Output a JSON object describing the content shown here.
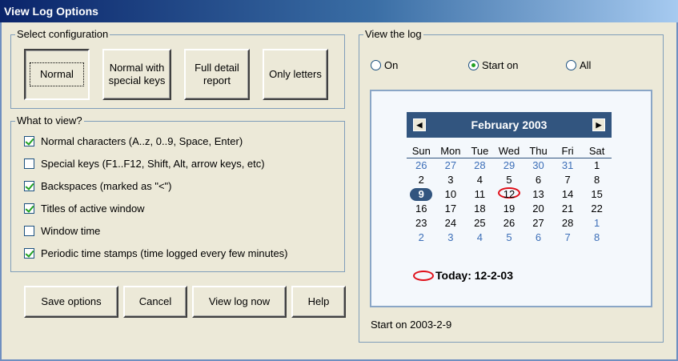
{
  "window": {
    "title": "View Log Options"
  },
  "config": {
    "legend": "Select configuration",
    "buttons": [
      {
        "id": "normal",
        "label": "Normal",
        "pressed": true
      },
      {
        "id": "normal-special",
        "label": "Normal with special keys",
        "pressed": false
      },
      {
        "id": "full-detail",
        "label": "Full detail report",
        "pressed": false
      },
      {
        "id": "only-letters",
        "label": "Only letters",
        "pressed": false
      }
    ]
  },
  "what_to_view": {
    "legend": "What to view?",
    "items": [
      {
        "label": "Normal characters (A..z, 0..9, Space, Enter)",
        "checked": true
      },
      {
        "label": "Special keys (F1..F12, Shift, Alt, arrow keys, etc)",
        "checked": false
      },
      {
        "label": "Backspaces (marked as \"<\")",
        "checked": true
      },
      {
        "label": "Titles of active window",
        "checked": true
      },
      {
        "label": "Window time",
        "checked": false
      },
      {
        "label": "Periodic time stamps (time logged every few minutes)",
        "checked": true
      }
    ]
  },
  "actions": {
    "save": "Save options",
    "cancel": "Cancel",
    "view_now": "View log now",
    "help": "Help"
  },
  "view_log": {
    "legend": "View the log",
    "radios": [
      {
        "label": "On",
        "selected": false
      },
      {
        "label": "Start on",
        "selected": true
      },
      {
        "label": "All",
        "selected": false
      }
    ],
    "status": "Start on 2003-2-9"
  },
  "calendar": {
    "month_label": "February 2003",
    "weekdays": [
      "Sun",
      "Mon",
      "Tue",
      "Wed",
      "Thu",
      "Fri",
      "Sat"
    ],
    "weeks": [
      [
        "26",
        "27",
        "28",
        "29",
        "30",
        "31",
        "1"
      ],
      [
        "2",
        "3",
        "4",
        "5",
        "6",
        "7",
        "8"
      ],
      [
        "9",
        "10",
        "11",
        "12",
        "13",
        "14",
        "15"
      ],
      [
        "16",
        "17",
        "18",
        "19",
        "20",
        "21",
        "22"
      ],
      [
        "23",
        "24",
        "25",
        "26",
        "27",
        "28",
        "1"
      ],
      [
        "2",
        "3",
        "4",
        "5",
        "6",
        "7",
        "8"
      ]
    ],
    "selected": "9",
    "today_date": "12",
    "today_label": "Today: 12-2-03",
    "colors": {
      "header": "#32557f",
      "other_month": "#3d6fb8",
      "today_ring": "#e0101a"
    }
  }
}
